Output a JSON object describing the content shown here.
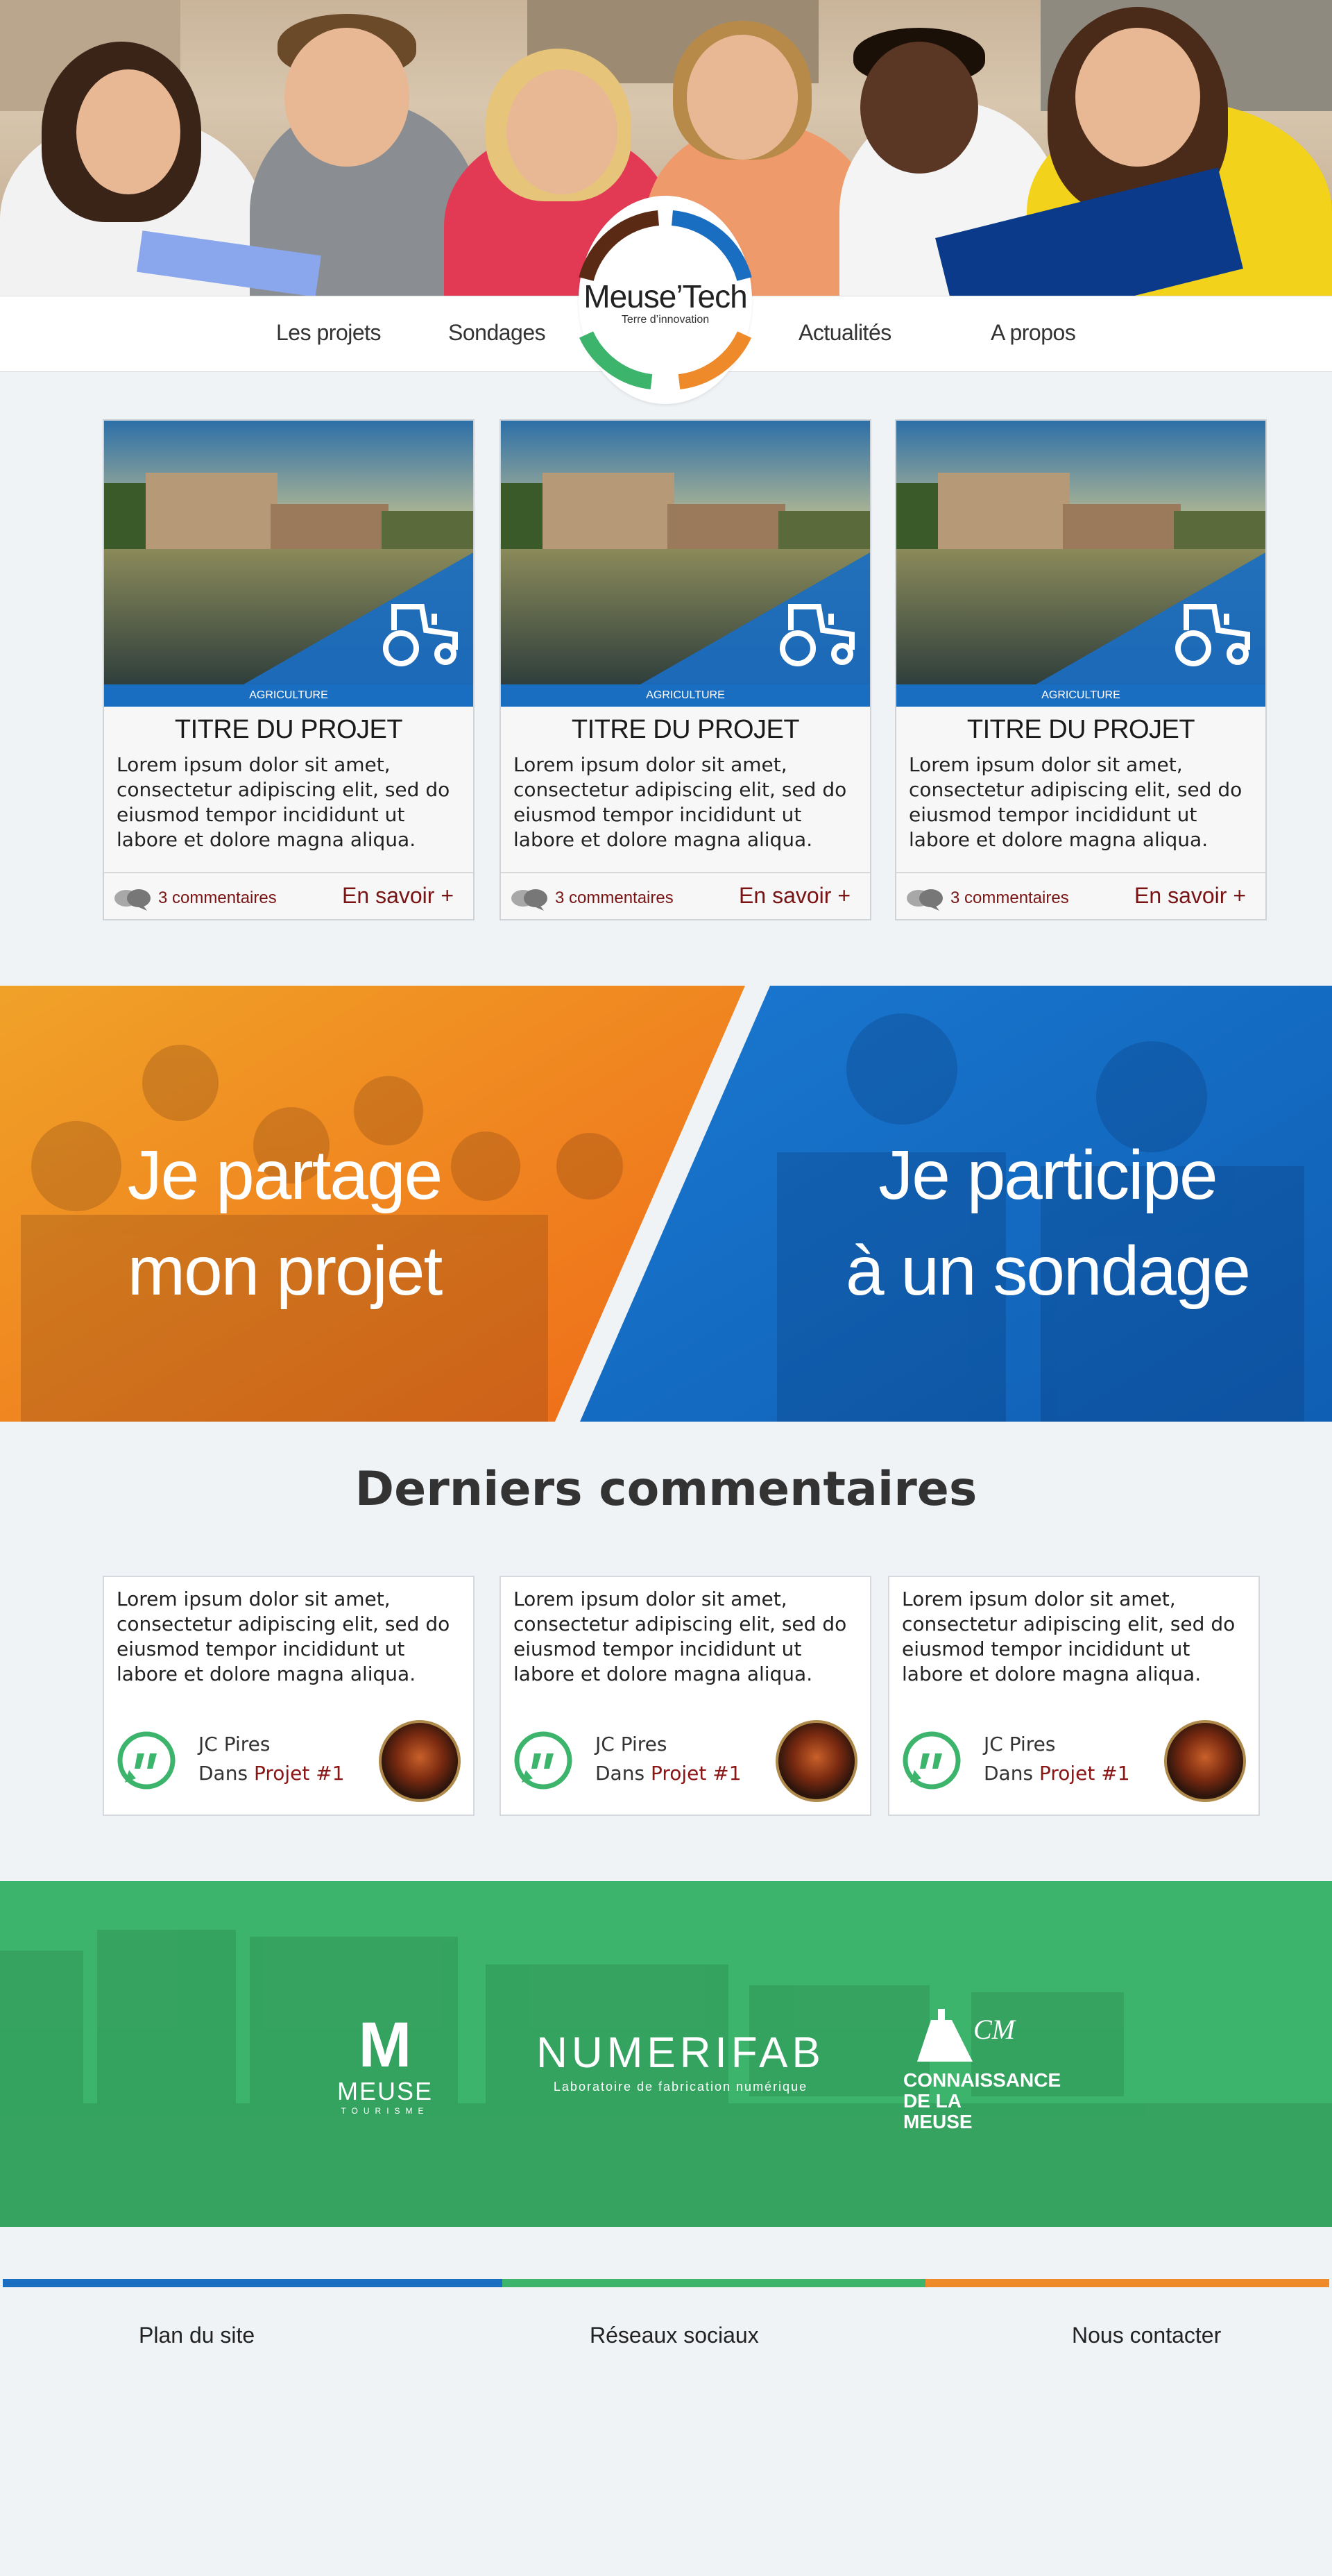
{
  "nav": {
    "items": [
      {
        "label": "Les projets"
      },
      {
        "label": "Sondages"
      },
      {
        "label": "Actualités"
      },
      {
        "label": "A propos"
      }
    ]
  },
  "logo": {
    "name": "Meuse’Tech",
    "tagline": "Terre d’innovation"
  },
  "projects": [
    {
      "category": "AGRICULTURE",
      "title": "TITRE DU PROJET",
      "text": "Lorem ipsum dolor sit amet, consectetur adipiscing elit, sed do eiusmod tempor incididunt ut labore et dolore magna aliqua.",
      "comments": "3 commentaires",
      "more": "En savoir +",
      "icon": "tractor-icon"
    },
    {
      "category": "AGRICULTURE",
      "title": "TITRE DU PROJET",
      "text": "Lorem ipsum dolor sit amet, consectetur adipiscing elit, sed do eiusmod tempor incididunt ut labore et dolore magna aliqua.",
      "comments": "3 commentaires",
      "more": "En savoir +",
      "icon": "tractor-icon"
    },
    {
      "category": "AGRICULTURE",
      "title": "TITRE DU PROJET",
      "text": "Lorem ipsum dolor sit amet, consectetur adipiscing elit, sed do eiusmod tempor incididunt ut labore et dolore magna aliqua.",
      "comments": "3 commentaires",
      "more": "En savoir +",
      "icon": "tractor-icon"
    }
  ],
  "cta": {
    "share": {
      "line1": "Je partage",
      "line2": "mon projet"
    },
    "survey": {
      "line1": "Je participe",
      "line2": "à un sondage"
    }
  },
  "comments_section": {
    "title": "Derniers commentaires",
    "items": [
      {
        "text": "Lorem ipsum dolor sit amet, consectetur adipiscing elit, sed do eiusmod tempor incididunt ut labore et dolore magna aliqua.",
        "author": "JC Pires",
        "in": "Dans",
        "project": "Projet #1"
      },
      {
        "text": "Lorem ipsum dolor sit amet, consectetur adipiscing elit, sed do eiusmod tempor incididunt ut labore et dolore magna aliqua.",
        "author": "JC Pires",
        "in": "Dans",
        "project": "Projet #1"
      },
      {
        "text": "Lorem ipsum dolor sit amet, consectetur adipiscing elit, sed do eiusmod tempor incididunt ut labore et dolore magna aliqua.",
        "author": "JC Pires",
        "in": "Dans",
        "project": "Projet #1"
      }
    ]
  },
  "partners": [
    {
      "name": "MEUSE",
      "sub": "TOURISME",
      "letter": "M"
    },
    {
      "name": "NUMERIFAB",
      "sub": "Laboratoire de fabrication numérique"
    },
    {
      "name": "CONNAISSANCE DE LA MEUSE",
      "mark": "CM"
    }
  ],
  "footer": {
    "links": [
      {
        "label": "Plan du site"
      },
      {
        "label": "Réseaux sociaux"
      },
      {
        "label": "Nous contacter"
      }
    ]
  },
  "colors": {
    "blue": "#1a6ec2",
    "green": "#3cb46c",
    "orange": "#ef8a2a",
    "brown": "#5b2a14",
    "link_red": "#7a1414"
  }
}
